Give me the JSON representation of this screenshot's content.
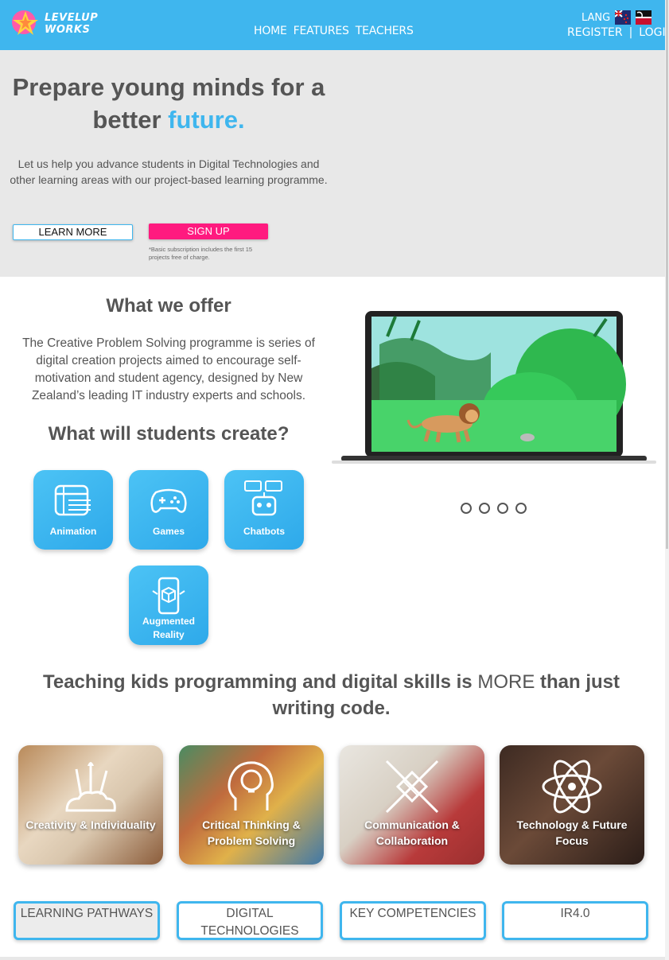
{
  "header": {
    "logo_text_line1": "LEVELUP",
    "logo_text_line2": "WORKS",
    "nav": [
      "HOME",
      "FEATURES",
      "TEACHERS"
    ],
    "lang_label": "LANG",
    "register_label": "REGISTER",
    "separator": "|",
    "login_label": "LOGIN"
  },
  "hero": {
    "title_part1": "Prepare young minds for a better ",
    "title_accent": "future.",
    "description": "Let us help you advance students in Digital Technologies and other learning areas with our project-based learning programme.",
    "learn_more_label": "LEARN MORE",
    "signup_label": "SIGN UP",
    "signup_note": "*Basic subscription includes the first 15 projects free of charge."
  },
  "offer": {
    "title": "What we offer",
    "description": "The Creative Problem Solving programme is series of digital creation projects aimed to encourage self-motivation and student agency, designed by New Zealand’s leading IT industry experts and schools.",
    "create_title": "What will students create?",
    "tiles": [
      "Animation",
      "Games",
      "Chatbots",
      "Augmented Reality"
    ]
  },
  "carousel": {
    "slide_count": 4
  },
  "skills": {
    "title_part1": "Teaching kids programming and digital skills is ",
    "title_more": "MORE",
    "title_part2": " than just writing code.",
    "cards": [
      "Creativity & Individuality",
      "Critical Thinking & Problem Solving",
      "Communication & Collaboration",
      "Technology & Future Focus"
    ]
  },
  "pathways": [
    "LEARNING PATHWAYS",
    "DIGITAL TECHNOLOGIES",
    "KEY COMPETENCIES",
    "IR4.0"
  ],
  "colors": {
    "brand_blue": "#3fb6ee",
    "signup_pink": "#ff1a7f",
    "hero_bg": "#e8e8e8"
  }
}
